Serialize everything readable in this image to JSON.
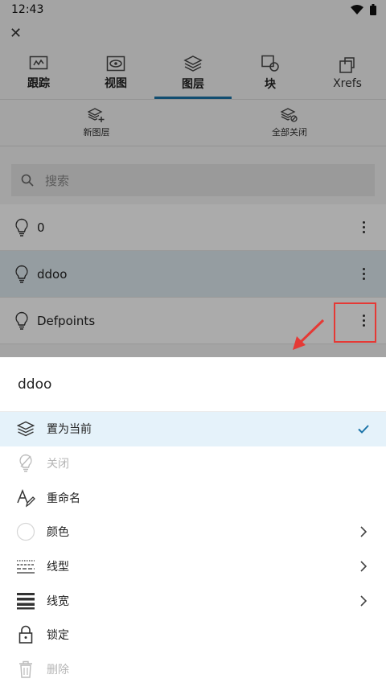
{
  "status_bar": {
    "time": "12:43"
  },
  "tabs": [
    {
      "label": "跟踪"
    },
    {
      "label": "视图"
    },
    {
      "label": "图层"
    },
    {
      "label": "块"
    },
    {
      "label": "Xrefs"
    }
  ],
  "layer_tools": {
    "new_layer": "新图层",
    "all_off": "全部关闭"
  },
  "search": {
    "placeholder": "搜索"
  },
  "layers": [
    {
      "name": "0"
    },
    {
      "name": "ddoo"
    },
    {
      "name": "Defpoints"
    }
  ],
  "sheet": {
    "title": "ddoo",
    "items": [
      {
        "label": "置为当前"
      },
      {
        "label": "关闭"
      },
      {
        "label": "重命名"
      },
      {
        "label": "颜色"
      },
      {
        "label": "线型"
      },
      {
        "label": "线宽"
      },
      {
        "label": "锁定"
      },
      {
        "label": "删除"
      }
    ]
  },
  "colors": {
    "accent": "#1a73a8",
    "annotation": "#e53935",
    "selected_row": "#dfeaf1",
    "current_item": "#e5f2fa"
  }
}
